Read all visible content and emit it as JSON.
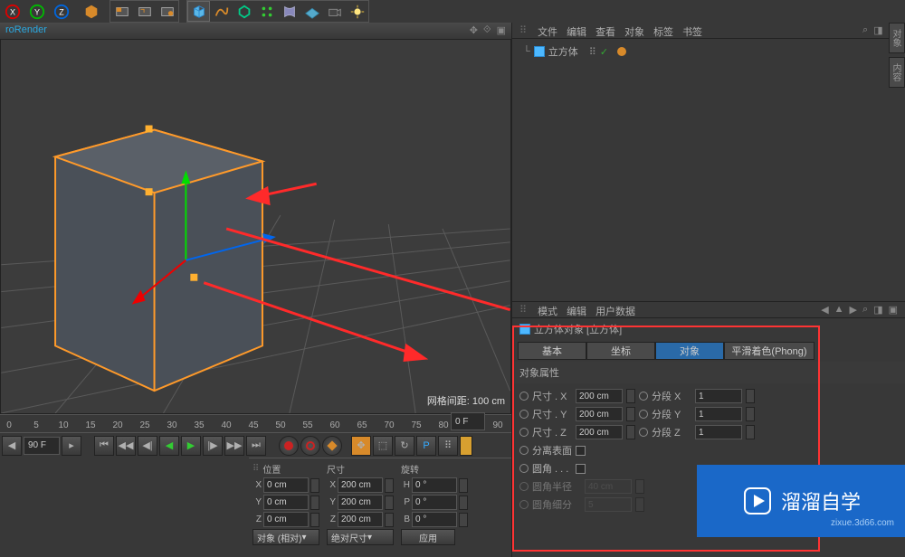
{
  "top_toolbar": {
    "axis_labels": [
      "X",
      "Y",
      "Z"
    ]
  },
  "viewport": {
    "title": "roRender",
    "grid_label": "网格间距: 100 cm"
  },
  "timeline": {
    "ticks": [
      0,
      5,
      10,
      15,
      20,
      25,
      30,
      35,
      40,
      45,
      50,
      55,
      60,
      65,
      70,
      75,
      80,
      85,
      90
    ],
    "start": "0 F",
    "end": "90 F"
  },
  "coord_panel": {
    "headers": {
      "pos": "位置",
      "size": "尺寸",
      "rot": "旋转"
    },
    "rows": [
      {
        "axis": "X",
        "pos": "0 cm",
        "size": "200 cm",
        "rot_axis": "H",
        "rot": "0 °"
      },
      {
        "axis": "Y",
        "pos": "0 cm",
        "size": "200 cm",
        "rot_axis": "P",
        "rot": "0 °"
      },
      {
        "axis": "Z",
        "pos": "0 cm",
        "size": "200 cm",
        "rot_axis": "B",
        "rot": "0 °"
      }
    ],
    "obj_mode": "对象 (相对)",
    "size_mode": "绝对尺寸",
    "apply": "应用"
  },
  "obj_panel": {
    "menu": [
      "文件",
      "编辑",
      "查看",
      "对象",
      "标签",
      "书签"
    ],
    "item": "立方体"
  },
  "attr_panel": {
    "menu": [
      "模式",
      "编辑",
      "用户数据"
    ],
    "title": "立方体对象 [立方体]",
    "tabs": [
      "基本",
      "坐标",
      "对象",
      "平滑着色(Phong)"
    ],
    "section": "对象属性",
    "props": {
      "size_x_label": "尺寸 . X",
      "size_x": "200 cm",
      "seg_x_label": "分段 X",
      "seg_x": "1",
      "size_y_label": "尺寸 . Y",
      "size_y": "200 cm",
      "seg_y_label": "分段 Y",
      "seg_y": "1",
      "size_z_label": "尺寸 . Z",
      "size_z": "200 cm",
      "seg_z_label": "分段 Z",
      "seg_z": "1",
      "separate_label": "分离表面",
      "fillet_label": "圆角 . . .",
      "fillet_radius_label": "圆角半径",
      "fillet_radius": "40 cm",
      "fillet_sub_label": "圆角细分",
      "fillet_sub": "5"
    }
  },
  "watermark": {
    "text": "溜溜自学",
    "sub": "zixue.3d66.com"
  }
}
